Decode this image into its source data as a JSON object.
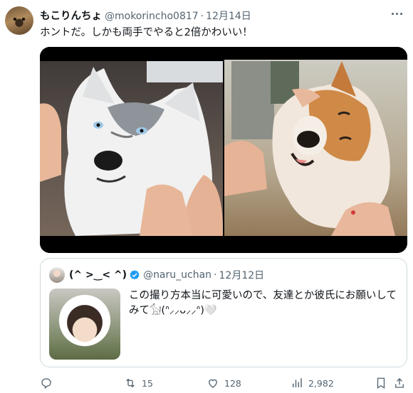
{
  "tweet": {
    "display_name": "もこりんちょ",
    "handle": "@mokorincho0817",
    "separator": "·",
    "date": "12月14日",
    "text": "ホントだ。しかも両手でやると2倍かわいい！"
  },
  "media": {
    "photos": [
      {
        "subject": "husky-cheeks-squeezed"
      },
      {
        "subject": "akita-cheeks-squeezed"
      }
    ]
  },
  "quote": {
    "display_name": "(^ >‿< ^)",
    "handle": "@naru_uchan",
    "separator": "·",
    "date": "12月12日",
    "text": "この撮り方本当に可愛いので、友達とか彼氏にお願いしてみて𓃩(ᐢ⸝⸝ᴗ⸝⸝ᐢ)🤍"
  },
  "actions": {
    "replies": "",
    "retweets": "15",
    "likes": "128",
    "views": "2,982"
  },
  "colors": {
    "text_primary": "#0f1419",
    "text_secondary": "#536471",
    "verified": "#1d9bf0",
    "border": "#cfd9de"
  }
}
